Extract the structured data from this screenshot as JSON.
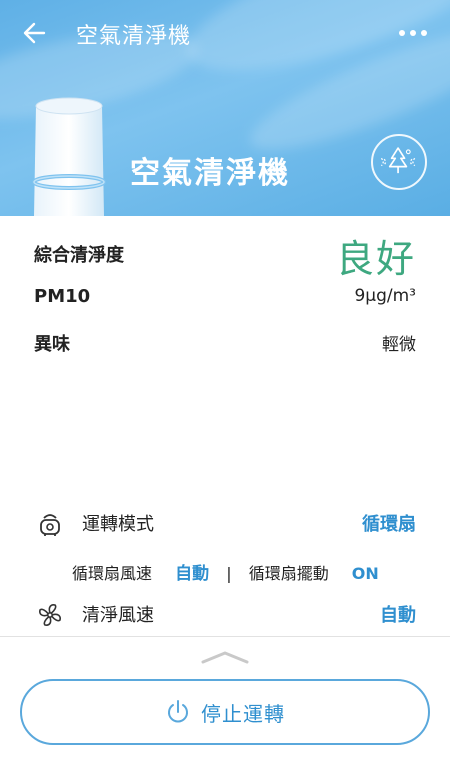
{
  "header": {
    "title": "空氣清淨機",
    "back_icon": "arrow-left-icon",
    "more_icon": "more-dots-icon"
  },
  "hero": {
    "device_name": "空氣清淨機",
    "mode_icon": "tree-airflow-icon"
  },
  "status": {
    "overall_label": "綜合清淨度",
    "overall_value": "良好",
    "pm10_label": "PM10",
    "pm10_value": "9μg/m³",
    "odor_label": "異味",
    "odor_value": "輕微"
  },
  "controls": {
    "mode_label": "運轉模式",
    "mode_value": "循環扇",
    "fan_speed_label": "循環扇風速",
    "fan_speed_value": "自動",
    "separator": "|",
    "swing_label": "循環扇擺動",
    "swing_value": "ON",
    "purify_speed_label": "清淨風速",
    "purify_speed_value": "自動"
  },
  "footer": {
    "stop_label": "停止運轉"
  },
  "colors": {
    "hero_blue": "#6db8ea",
    "accent_blue": "#2f8fcf",
    "good_green": "#3ea880"
  }
}
